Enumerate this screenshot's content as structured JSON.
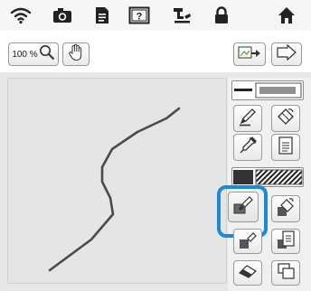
{
  "status_bar": {
    "icons": [
      "wifi-icon",
      "camera-icon",
      "document-icon",
      "help-icon",
      "embroidery-machine-icon",
      "lock-icon",
      "home-icon"
    ]
  },
  "toolbar": {
    "zoom_value": "100 %",
    "icons": {
      "zoom": "magnifier-icon",
      "pan": "hand-icon",
      "import": "import-image-icon",
      "next": "next-arrow-icon"
    }
  },
  "panel": {
    "line_tools": [
      "line-pen-icon",
      "line-eraser-icon",
      "line-eyedropper-icon",
      "line-properties-icon"
    ],
    "region_tools": [
      "region-brush-icon",
      "region-fill-icon",
      "region-eyedropper-icon",
      "region-properties-icon"
    ],
    "bottom_tools": [
      "eraser-icon",
      "select-area-icon"
    ],
    "selected_tool": "region-brush-icon"
  },
  "colors": {
    "selection_ring": "#1e88d9",
    "stroke": "#4a4a4a",
    "canvas_bg": "#e5e5e5"
  }
}
